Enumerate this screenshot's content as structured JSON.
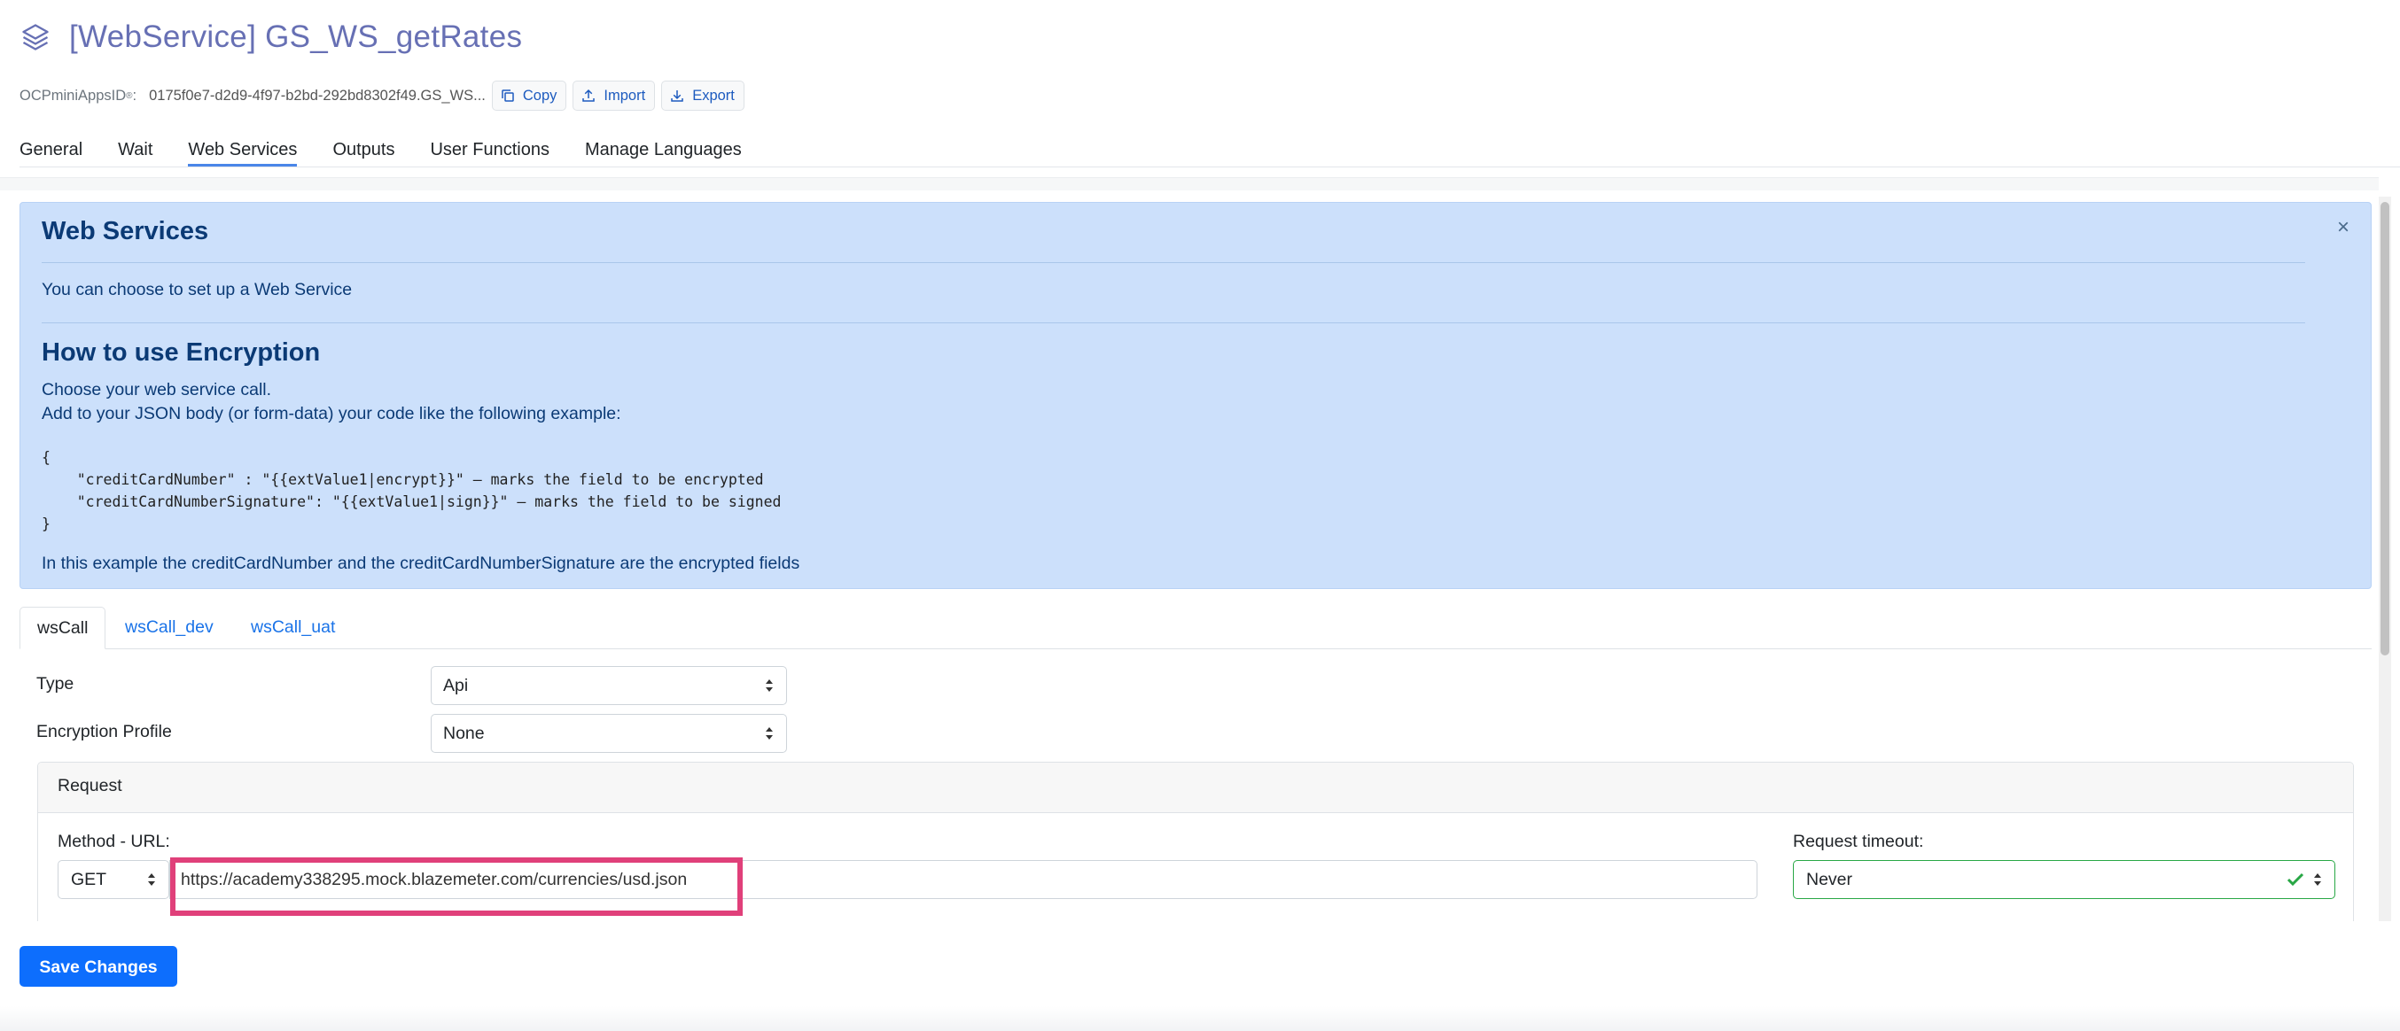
{
  "header": {
    "title": "[WebService] GS_WS_getRates",
    "meta_label": "OCPminiAppsID",
    "meta_sup": "®",
    "meta_suffix": ":",
    "meta_value": "0175f0e7-d2d9-4f97-b2bd-292bd8302f49.GS_WS...",
    "copy_label": "Copy",
    "import_label": "Import",
    "export_label": "Export"
  },
  "tabs": [
    {
      "label": "General"
    },
    {
      "label": "Wait"
    },
    {
      "label": "Web Services",
      "active": true
    },
    {
      "label": "Outputs"
    },
    {
      "label": "User Functions"
    },
    {
      "label": "Manage Languages"
    }
  ],
  "info": {
    "title": "Web Services",
    "intro": "You can choose to set up a Web Service",
    "encryption_title": "How to use Encryption",
    "line1": "Choose your web service call.",
    "line2": "Add to your JSON body (or form-data) your code like the following example:",
    "code": [
      "{",
      "    \"creditCardNumber\" : \"{{extValue1|encrypt}}\" — marks the field to be encrypted",
      "    \"creditCardNumberSignature\": \"{{extValue1|sign}}\" — marks the field to be signed",
      "}"
    ],
    "footer": "In this example the creditCardNumber and the creditCardNumberSignature are the encrypted fields",
    "close": "×"
  },
  "sub_tabs": [
    {
      "label": "wsCall",
      "active": true
    },
    {
      "label": "wsCall_dev"
    },
    {
      "label": "wsCall_uat"
    }
  ],
  "form": {
    "type_label": "Type",
    "type_value": "Api",
    "encryption_label": "Encryption Profile",
    "encryption_value": "None",
    "request_title": "Request",
    "method_url_label": "Method - URL:",
    "method_value": "GET",
    "url_value": "https://academy338295.mock.blazemeter.com/currencies/usd.json",
    "timeout_label": "Request timeout:",
    "timeout_value": "Never"
  },
  "save_label": "Save Changes",
  "colors": {
    "accent": "#0d6efd",
    "title": "#6770b4",
    "info_bg": "#cce0fb",
    "highlight": "#e0407a",
    "valid": "#28a745"
  }
}
